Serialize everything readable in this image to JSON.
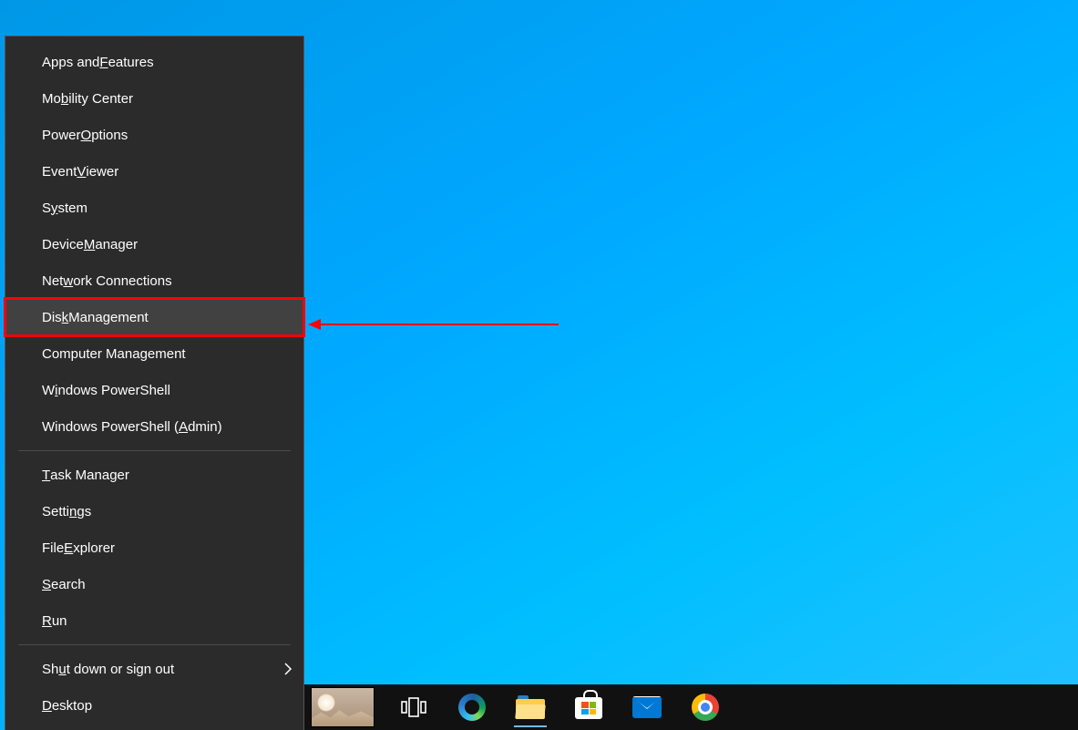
{
  "winx": {
    "groups": [
      [
        {
          "id": "apps-and-features",
          "pre": "Apps and ",
          "m": "F",
          "post": "eatures"
        },
        {
          "id": "mobility-center",
          "pre": "Mo",
          "m": "b",
          "post": "ility Center"
        },
        {
          "id": "power-options",
          "pre": "Power ",
          "m": "O",
          "post": "ptions"
        },
        {
          "id": "event-viewer",
          "pre": "Event ",
          "m": "V",
          "post": "iewer"
        },
        {
          "id": "system",
          "pre": "S",
          "m": "y",
          "post": "stem"
        },
        {
          "id": "device-manager",
          "pre": "Device ",
          "m": "M",
          "post": "anager"
        },
        {
          "id": "network-connections",
          "pre": "Net",
          "m": "w",
          "post": "ork Connections"
        },
        {
          "id": "disk-management",
          "pre": "Dis",
          "m": "k",
          "post": " Management",
          "hover": true,
          "highlight": true
        },
        {
          "id": "computer-management",
          "pre": "Computer Mana",
          "m": "g",
          "post": "ement"
        },
        {
          "id": "windows-powershell",
          "pre": "W",
          "m": "i",
          "post": "ndows PowerShell"
        },
        {
          "id": "windows-powershell-admin",
          "pre": "Windows PowerShell (",
          "m": "A",
          "post": "dmin)"
        }
      ],
      [
        {
          "id": "task-manager",
          "pre": "",
          "m": "T",
          "post": "ask Manager"
        },
        {
          "id": "settings",
          "pre": "Setti",
          "m": "n",
          "post": "gs"
        },
        {
          "id": "file-explorer",
          "pre": "File ",
          "m": "E",
          "post": "xplorer"
        },
        {
          "id": "search",
          "pre": "",
          "m": "S",
          "post": "earch"
        },
        {
          "id": "run",
          "pre": "",
          "m": "R",
          "post": "un"
        }
      ],
      [
        {
          "id": "shut-down-or-sign-out",
          "pre": "Sh",
          "m": "u",
          "post": "t down or sign out",
          "submenu": true
        },
        {
          "id": "desktop",
          "pre": "",
          "m": "D",
          "post": "esktop"
        }
      ]
    ]
  },
  "taskbar": {
    "items": [
      {
        "id": "weather-widget",
        "icon": "weather-icon"
      },
      {
        "id": "task-view-button",
        "icon": "task-view-icon"
      },
      {
        "id": "edge-browser",
        "icon": "edge-icon"
      },
      {
        "id": "file-explorer-app",
        "icon": "file-explorer-icon",
        "active": true
      },
      {
        "id": "microsoft-store",
        "icon": "microsoft-store-icon"
      },
      {
        "id": "mail-app",
        "icon": "mail-icon"
      },
      {
        "id": "google-chrome",
        "icon": "chrome-icon"
      }
    ]
  }
}
